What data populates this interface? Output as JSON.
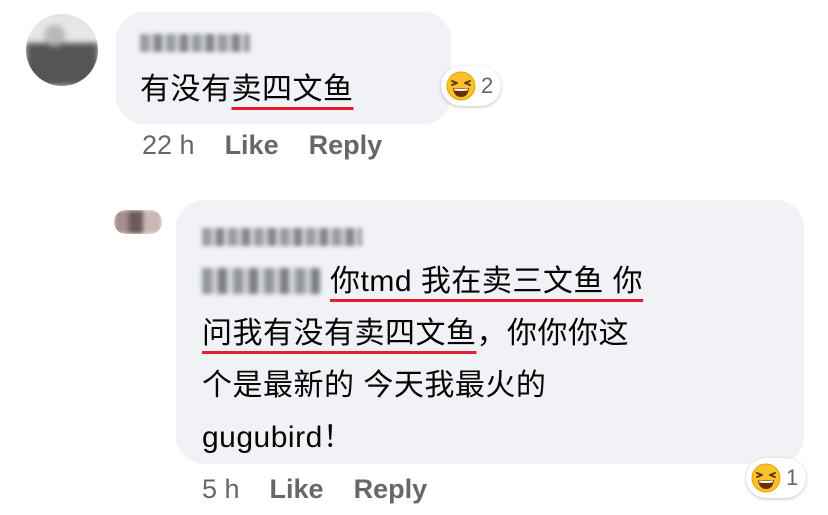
{
  "comments": [
    {
      "text_plain": "有没有",
      "text_underlined": "卖四文鱼",
      "time": "22 h",
      "like_label": "Like",
      "reply_label": "Reply",
      "reaction_count": "2"
    },
    {
      "line1_underlined": "你tmd 我在卖三文鱼 你",
      "line2_underlined": "问我有没有卖四文鱼",
      "line2_rest": "，你你你这",
      "line3": "个是最新的 今天我最火的",
      "line4": "gugubird！",
      "time": "5 h",
      "like_label": "Like",
      "reply_label": "Reply",
      "reaction_count": "1"
    }
  ],
  "icons": {
    "reaction": "laughing-face-icon"
  },
  "colors": {
    "bubble": "#f0f2f5",
    "underline": "#e4202e",
    "meta_text": "#65676b"
  }
}
